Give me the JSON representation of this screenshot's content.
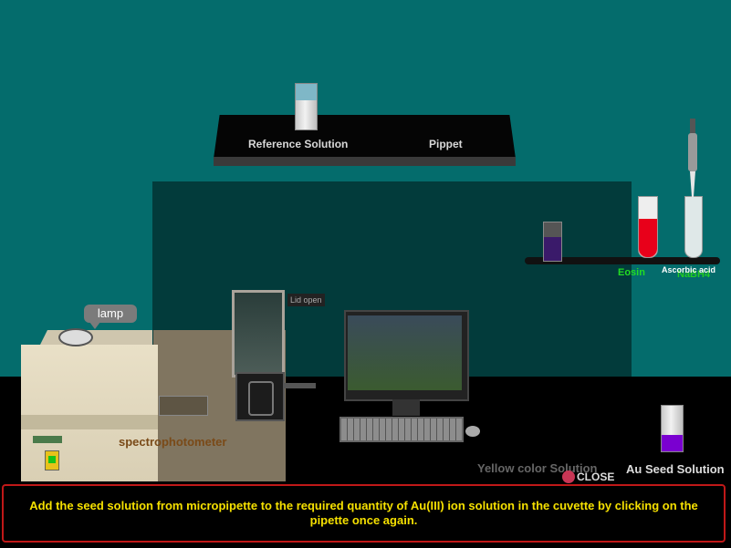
{
  "shelf": {
    "reference_label": "Reference Solution",
    "pipette_label": "Pippet"
  },
  "side_shelf": {
    "eosin_label": "Eosin",
    "nabh4_label": "NaBH4",
    "ascorbic_label": "Ascorbic acid"
  },
  "instrument": {
    "lamp_label": "lamp",
    "lid_label": "Lid open",
    "name_label": "spectrophotometer"
  },
  "bench": {
    "yellow_label": "Yellow color Solution",
    "seed_label": "Au Seed Solution",
    "close_label": "CLOSE"
  },
  "instruction": {
    "text": "Add the seed solution from micropipette to the required quantity of Au(III) ion solution in the cuvette by clicking on the pipette once again."
  },
  "colors": {
    "wall": "#046c6c",
    "instruction_text": "#f5e000",
    "instruction_border": "#c01818",
    "eosin_label": "#22dd22",
    "red_solution": "#e8001a",
    "purple_solution": "#7a00d0"
  },
  "icons": [
    "lamp-icon",
    "close-icon",
    "pipette-icon"
  ]
}
